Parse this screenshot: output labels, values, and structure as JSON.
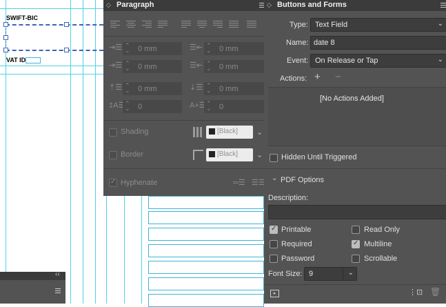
{
  "canvas": {
    "swift_label": "SWIFT-BIC",
    "vat_label": "VAT ID"
  },
  "paragraph_panel": {
    "title": "Paragraph",
    "left_indent": "0 mm",
    "right_indent": "0 mm",
    "first_line_indent": "0 mm",
    "last_line_indent": "0 mm",
    "space_before": "0 mm",
    "space_after": "0 mm",
    "drop_cap_lines": "0",
    "drop_cap_chars": "0",
    "shading_label": "Shading",
    "shading_color": "[Black]",
    "border_label": "Border",
    "border_color": "[Black]",
    "hyphenate_label": "Hyphenate",
    "hyphenate_checked": true
  },
  "buttons_forms_panel": {
    "title": "Buttons and Forms",
    "type_label": "Type:",
    "type_value": "Text Field",
    "name_label": "Name:",
    "name_value": "date 8",
    "event_label": "Event:",
    "event_value": "On Release or Tap",
    "actions_label": "Actions:",
    "add_action": "+",
    "remove_action": "−",
    "no_actions": "[No Actions Added]",
    "hidden_label": "Hidden Until Triggered",
    "pdf_options_label": "PDF Options",
    "description_label": "Description:",
    "description_value": "",
    "printable_label": "Printable",
    "read_only_label": "Read Only",
    "required_label": "Required",
    "multiline_label": "Multiline",
    "password_label": "Password",
    "scrollable_label": "Scrollable",
    "font_size_label": "Font Size:",
    "font_size_value": "9",
    "checks": {
      "printable": true,
      "read_only": false,
      "required": false,
      "multiline": true,
      "password": false,
      "scrollable": false,
      "hidden": false
    }
  },
  "colors": {
    "panel_bg": "#535353",
    "header_bg": "#3b3b3b",
    "guide": "#4fd2e3"
  }
}
